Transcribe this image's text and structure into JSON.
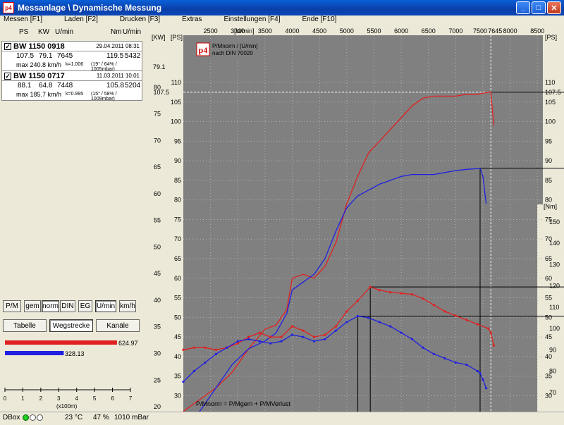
{
  "window": {
    "title": "Messanlage \\ Dynamische Messung",
    "app_icon": "p4"
  },
  "menu": [
    "Messen [F1]",
    "Laden [F2]",
    "Drucken [F3]",
    "Extras",
    "Einstellungen [F4]",
    "Ende [F10]"
  ],
  "panel_headers": {
    "ps": "PS",
    "kw": "KW",
    "umin": "U/min",
    "nm": "Nm",
    "umin2": "U/min"
  },
  "cars": [
    {
      "name": "BW 1150 0918",
      "date": "29.04.2011 08:31",
      "ps": "107.5",
      "kw": "79.1",
      "rpm": "7645",
      "nm": "119.5",
      "nm_rpm": "5432",
      "vmax": "max 240.8 km/h",
      "k": "k=1.006",
      "cond": "(19° / 64% / 1005mbar)",
      "color": "#e02020",
      "checked": "✓"
    },
    {
      "name": "BW 1150 0717",
      "date": "11.03.2011 10:01",
      "ps": "88.1",
      "kw": "64.8",
      "rpm": "7448",
      "nm": "105.8",
      "nm_rpm": "5204",
      "vmax": "max 185.7 km/h",
      "k": "k=0.995",
      "cond": "(15° / 58% / 1009mbar)",
      "color": "#2020e0",
      "checked": "✓"
    }
  ],
  "buttons": {
    "pm": "P/M",
    "gem": "gem",
    "norm": "norm",
    "din": "DIN",
    "eg": "EG",
    "umin": "U/min",
    "kmh": "km/h"
  },
  "tabs": {
    "tabelle": "Tabelle",
    "wegstrecke": "Wegstrecke",
    "kanaele": "Kanäle"
  },
  "distance_bars": {
    "values": [
      624.97,
      328.13
    ],
    "labels": [
      "624.97",
      "328.13"
    ],
    "colors": [
      "#e02020",
      "#2020e0"
    ],
    "ticks": [
      "0",
      "1",
      "2",
      "3",
      "4",
      "5",
      "6",
      "7"
    ],
    "unit": "(x100m)"
  },
  "status": {
    "dbox": "DBox",
    "temp": "23 °C",
    "humidity": "47 %",
    "pressure": "1010 mBar"
  },
  "chart_data": {
    "type": "line",
    "legend_title": "P/Mnorm / [U/min]",
    "legend_sub": "nach DIN 70020",
    "logo": "p4",
    "footnote": "P/Mnorm = P/Mgem + P/MVerlust",
    "x_ticks": [
      "2500",
      "3000",
      "3500",
      "4000",
      "4500",
      "5000",
      "5500",
      "6000",
      "6500",
      "7000",
      "7500",
      "7645",
      "8000",
      "8500"
    ],
    "x_unit": "[U/min]",
    "xlim": [
      2000,
      8600
    ],
    "kw_label": "[KW]",
    "kw_ticks": [
      "15",
      "20",
      "25",
      "30",
      "35",
      "40",
      "45",
      "50",
      "55",
      "60",
      "65",
      "70",
      "75",
      "80"
    ],
    "ps_label": "[PS]",
    "ps_ticks": [
      "20",
      "25",
      "30",
      "35",
      "40",
      "45",
      "50",
      "55",
      "60",
      "65",
      "70",
      "75",
      "80",
      "85",
      "90",
      "95",
      "100",
      "105",
      "110"
    ],
    "nm_label": "[Nm]",
    "nm_ticks": [
      "20",
      "70",
      "80",
      "90",
      "100",
      "110",
      "120",
      "130",
      "140",
      "150",
      "160"
    ],
    "markers": {
      "kw": "79.1",
      "ps": "107.5"
    },
    "series": [
      {
        "name": "BW 1150 0918",
        "kind": "power",
        "color": "#e02020",
        "x": [
          2000,
          2300,
          2600,
          2900,
          3200,
          3500,
          3700,
          3900,
          4000,
          4200,
          4400,
          4600,
          4800,
          5000,
          5200,
          5400,
          5600,
          5800,
          6000,
          6200,
          6400,
          6600,
          6800,
          7000,
          7200,
          7400,
          7600,
          7645,
          7700
        ],
        "y": [
          26,
          29,
          32,
          36,
          42,
          47,
          48,
          52,
          60,
          61,
          60,
          63,
          69,
          79,
          86,
          92,
          95,
          98,
          101,
          104,
          106,
          106.5,
          106.5,
          106.5,
          107,
          107,
          107.5,
          107.5,
          99
        ]
      },
      {
        "name": "BW 1150 0717",
        "kind": "power",
        "color": "#2020e0",
        "x": [
          2000,
          2300,
          2600,
          2900,
          3200,
          3500,
          3700,
          3900,
          4000,
          4200,
          4400,
          4600,
          4800,
          5000,
          5200,
          5400,
          5600,
          5800,
          6000,
          6200,
          6400,
          6600,
          6800,
          7000,
          7200,
          7400,
          7448,
          7500,
          7560
        ],
        "y": [
          20,
          26,
          32,
          38,
          42,
          44,
          46,
          51,
          57,
          59,
          61,
          65,
          72,
          78,
          81,
          82.5,
          84,
          85,
          86,
          86.5,
          86.5,
          86.5,
          87,
          87.5,
          87.8,
          88,
          88.1,
          86,
          79
        ]
      },
      {
        "name": "BW 1150 0918",
        "kind": "torque",
        "color": "#e02020",
        "x": [
          2000,
          2200,
          2400,
          2600,
          2800,
          3000,
          3200,
          3400,
          3600,
          3800,
          4000,
          4200,
          4400,
          4600,
          4800,
          5000,
          5200,
          5432,
          5600,
          5800,
          6000,
          6200,
          6400,
          6600,
          6800,
          7000,
          7200,
          7400,
          7600,
          7645,
          7700
        ],
        "y": [
          90,
          91,
          91,
          90,
          91,
          93,
          96,
          98,
          96,
          96,
          101,
          99,
          96,
          97,
          101,
          108,
          113,
          119.5,
          118,
          117,
          116.5,
          116,
          114,
          111,
          108,
          106,
          104,
          102,
          100,
          98,
          92
        ]
      },
      {
        "name": "BW 1150 0717",
        "kind": "torque",
        "color": "#2020e0",
        "x": [
          2000,
          2200,
          2400,
          2600,
          2800,
          3000,
          3200,
          3400,
          3600,
          3800,
          4000,
          4200,
          4400,
          4600,
          4800,
          5000,
          5204,
          5400,
          5600,
          5800,
          6000,
          6200,
          6400,
          6600,
          6800,
          7000,
          7200,
          7400,
          7448,
          7500,
          7560
        ],
        "y": [
          75,
          80,
          84,
          88,
          91,
          94,
          95,
          94,
          93,
          94,
          97,
          96,
          94,
          95,
          99,
          103,
          105.8,
          105,
          103,
          101,
          98,
          95,
          91,
          88,
          86,
          84,
          83,
          80,
          79,
          76,
          72
        ]
      }
    ]
  }
}
